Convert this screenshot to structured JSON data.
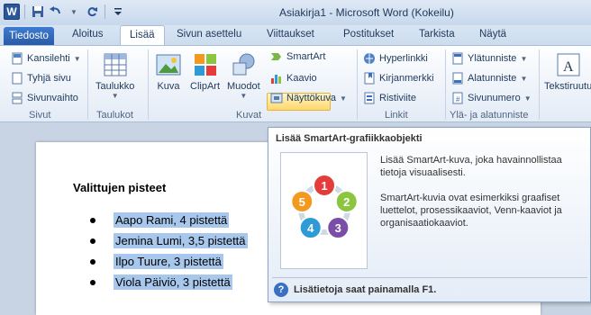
{
  "window": {
    "title": "Asiakirja1 - Microsoft Word (Kokeilu)"
  },
  "quick_access": {
    "app_icon": "word-logo-icon",
    "app_letter": "W",
    "icons": [
      "save-icon",
      "undo-icon",
      "redo-icon",
      "customize-icon"
    ]
  },
  "tabs": {
    "file": "Tiedosto",
    "items": [
      "Aloitus",
      "Lisää",
      "Sivun asettelu",
      "Viittaukset",
      "Postitukset",
      "Tarkista",
      "Näytä"
    ],
    "active": "Lisää"
  },
  "ribbon": {
    "pages": {
      "label": "Sivut",
      "cover": "Kansilehti",
      "blank": "Tyhjä sivu",
      "break": "Sivunvaihto"
    },
    "tables": {
      "label": "Taulukot",
      "table": "Taulukko"
    },
    "illustrations": {
      "label": "Kuvat",
      "picture": "Kuva",
      "clipart": "ClipArt",
      "shapes": "Muodot",
      "smartart": "SmartArt",
      "chart": "Kaavio",
      "screenshot": "Näyttökuva"
    },
    "links": {
      "label": "Linkit",
      "hyperlink": "Hyperlinkki",
      "bookmark": "Kirjanmerkki",
      "crossref": "Ristiviite"
    },
    "header_footer": {
      "label": "Ylä- ja alatunniste",
      "header": "Ylätunniste",
      "footer": "Alatunniste",
      "page_number": "Sivunumero"
    },
    "text": {
      "textbox": "Tekstiruutu"
    }
  },
  "document": {
    "heading": "Valittujen pisteet",
    "items": [
      "Aapo Rami, 4 pistettä",
      "Jemina Lumi, 3,5 pistettä",
      "Ilpo Tuure, 3 pistettä",
      "Viola Päiviö, 3 pistettä"
    ]
  },
  "tooltip": {
    "title": "Lisää SmartArt-grafiikkaobjekti",
    "para1": "Lisää SmartArt-kuva, joka havainnollistaa tietoja visuaalisesti.",
    "para2": "SmartArt-kuvia ovat esimerkiksi graafiset luettelot, prosessikaaviot, Venn-kaaviot ja organisaatiokaaviot.",
    "help": "Lisätietoja saat painamalla F1.",
    "diagram_numbers": [
      "1",
      "2",
      "3",
      "4",
      "5"
    ],
    "diagram_colors": [
      "#e63b3b",
      "#8cc63f",
      "#7a4ea8",
      "#2e9bd6",
      "#f39a1e"
    ]
  }
}
